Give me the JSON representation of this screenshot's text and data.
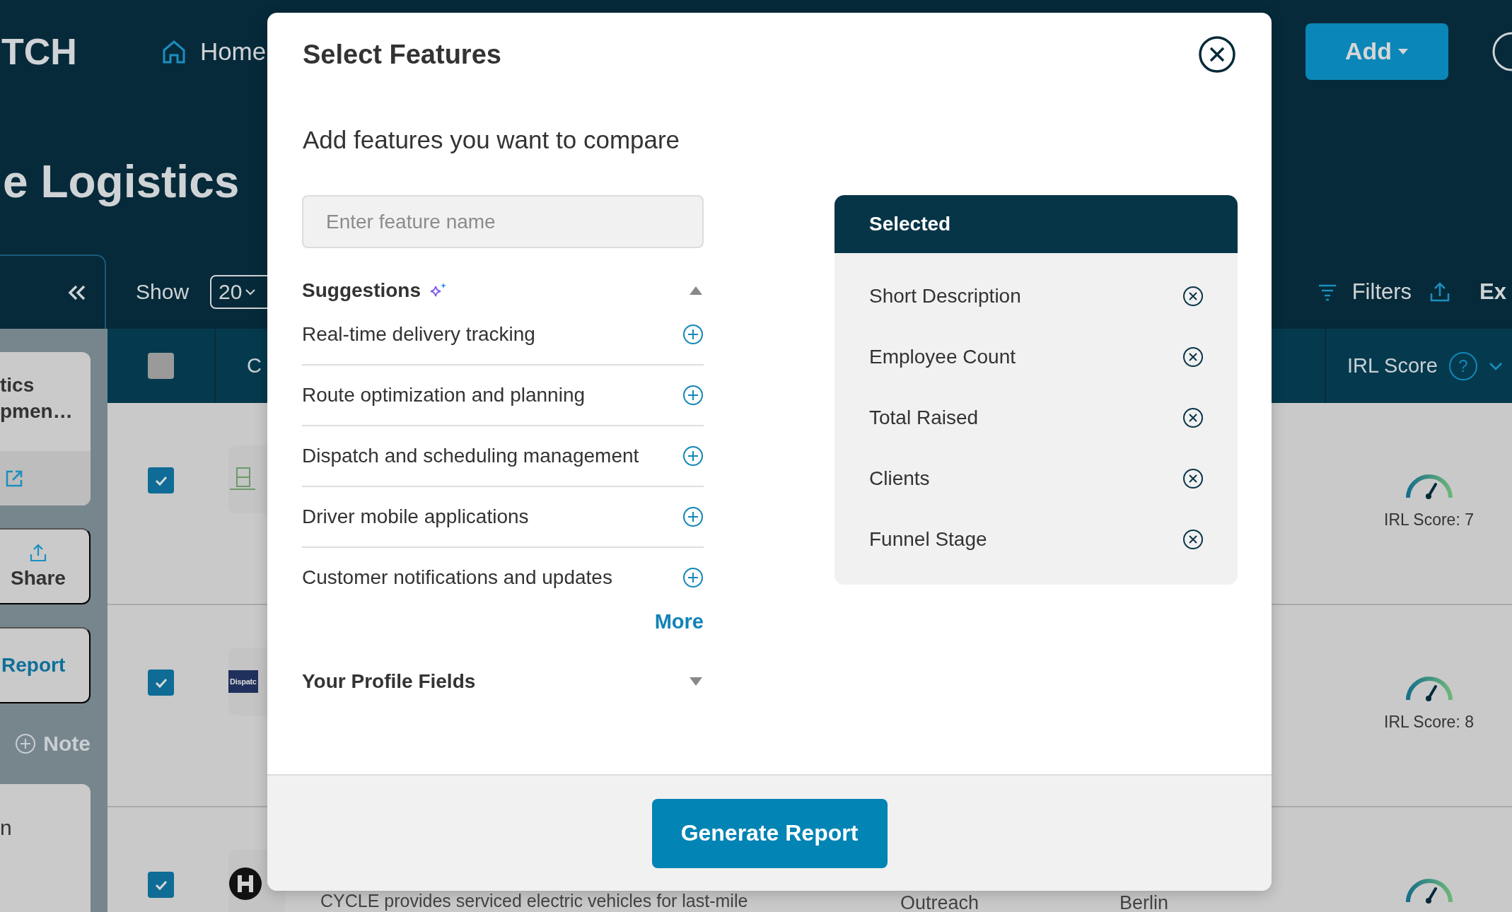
{
  "app": {
    "logo": "TCH",
    "nav": [
      {
        "label": "Home"
      }
    ],
    "add_button": "Add",
    "page_title": "e Logistics"
  },
  "toolbar": {
    "show_label": "Show",
    "page_size": "20",
    "filters": "Filters",
    "export": "Ex"
  },
  "sidebar": {
    "card_lines": [
      "tics",
      "pmen…"
    ],
    "share": "Share",
    "report": "Report",
    "note": "Note",
    "card_text": "n"
  },
  "table": {
    "columns": [
      "C",
      "IRL Score"
    ],
    "help": "?",
    "header_checked": false,
    "rows": [
      {
        "checked": true,
        "kind": "frontdoor",
        "score": "IRL Score: 7"
      },
      {
        "checked": true,
        "kind": "text",
        "logo_text": "Dispatc",
        "score": "IRL Score: 8"
      },
      {
        "checked": true,
        "kind": "mark",
        "description": "CYCLE provides serviced electric vehicles for last-mile",
        "stage": "Outreach",
        "location": "Berlin"
      }
    ]
  },
  "modal": {
    "title": "Select Features",
    "subtitle": "Add features you want to compare",
    "search": {
      "placeholder": "Enter feature name"
    },
    "suggestions": {
      "title": "Suggestions",
      "expanded": true,
      "items": [
        "Real-time delivery tracking",
        "Route optimization and planning",
        "Dispatch and scheduling management",
        "Driver mobile applications",
        "Customer notifications and updates"
      ],
      "more": "More"
    },
    "profile_fields": {
      "title": "Your Profile Fields",
      "expanded": false
    },
    "selected": {
      "title": "Selected",
      "items": [
        "Short Description",
        "Employee Count",
        "Total Raised",
        "Clients",
        "Funnel Stage"
      ]
    },
    "primary_button": "Generate Report"
  }
}
